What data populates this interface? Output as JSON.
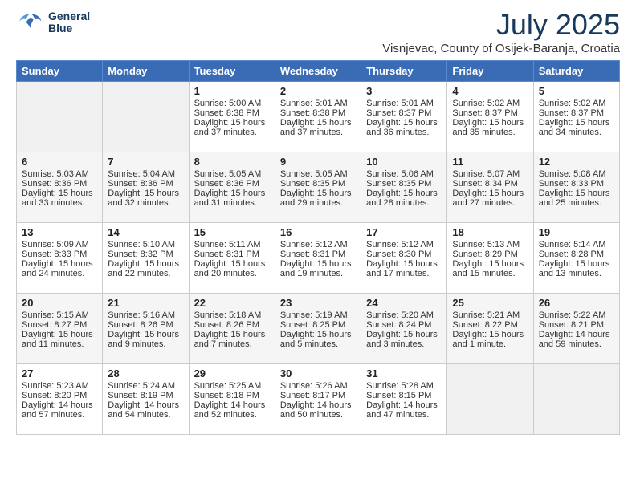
{
  "header": {
    "logo_line1": "General",
    "logo_line2": "Blue",
    "month_year": "July 2025",
    "location": "Visnjevac, County of Osijek-Baranja, Croatia"
  },
  "days_of_week": [
    "Sunday",
    "Monday",
    "Tuesday",
    "Wednesday",
    "Thursday",
    "Friday",
    "Saturday"
  ],
  "weeks": [
    [
      {
        "day": "",
        "content": ""
      },
      {
        "day": "",
        "content": ""
      },
      {
        "day": "1",
        "content": "Sunrise: 5:00 AM\nSunset: 8:38 PM\nDaylight: 15 hours and 37 minutes."
      },
      {
        "day": "2",
        "content": "Sunrise: 5:01 AM\nSunset: 8:38 PM\nDaylight: 15 hours and 37 minutes."
      },
      {
        "day": "3",
        "content": "Sunrise: 5:01 AM\nSunset: 8:37 PM\nDaylight: 15 hours and 36 minutes."
      },
      {
        "day": "4",
        "content": "Sunrise: 5:02 AM\nSunset: 8:37 PM\nDaylight: 15 hours and 35 minutes."
      },
      {
        "day": "5",
        "content": "Sunrise: 5:02 AM\nSunset: 8:37 PM\nDaylight: 15 hours and 34 minutes."
      }
    ],
    [
      {
        "day": "6",
        "content": "Sunrise: 5:03 AM\nSunset: 8:36 PM\nDaylight: 15 hours and 33 minutes."
      },
      {
        "day": "7",
        "content": "Sunrise: 5:04 AM\nSunset: 8:36 PM\nDaylight: 15 hours and 32 minutes."
      },
      {
        "day": "8",
        "content": "Sunrise: 5:05 AM\nSunset: 8:36 PM\nDaylight: 15 hours and 31 minutes."
      },
      {
        "day": "9",
        "content": "Sunrise: 5:05 AM\nSunset: 8:35 PM\nDaylight: 15 hours and 29 minutes."
      },
      {
        "day": "10",
        "content": "Sunrise: 5:06 AM\nSunset: 8:35 PM\nDaylight: 15 hours and 28 minutes."
      },
      {
        "day": "11",
        "content": "Sunrise: 5:07 AM\nSunset: 8:34 PM\nDaylight: 15 hours and 27 minutes."
      },
      {
        "day": "12",
        "content": "Sunrise: 5:08 AM\nSunset: 8:33 PM\nDaylight: 15 hours and 25 minutes."
      }
    ],
    [
      {
        "day": "13",
        "content": "Sunrise: 5:09 AM\nSunset: 8:33 PM\nDaylight: 15 hours and 24 minutes."
      },
      {
        "day": "14",
        "content": "Sunrise: 5:10 AM\nSunset: 8:32 PM\nDaylight: 15 hours and 22 minutes."
      },
      {
        "day": "15",
        "content": "Sunrise: 5:11 AM\nSunset: 8:31 PM\nDaylight: 15 hours and 20 minutes."
      },
      {
        "day": "16",
        "content": "Sunrise: 5:12 AM\nSunset: 8:31 PM\nDaylight: 15 hours and 19 minutes."
      },
      {
        "day": "17",
        "content": "Sunrise: 5:12 AM\nSunset: 8:30 PM\nDaylight: 15 hours and 17 minutes."
      },
      {
        "day": "18",
        "content": "Sunrise: 5:13 AM\nSunset: 8:29 PM\nDaylight: 15 hours and 15 minutes."
      },
      {
        "day": "19",
        "content": "Sunrise: 5:14 AM\nSunset: 8:28 PM\nDaylight: 15 hours and 13 minutes."
      }
    ],
    [
      {
        "day": "20",
        "content": "Sunrise: 5:15 AM\nSunset: 8:27 PM\nDaylight: 15 hours and 11 minutes."
      },
      {
        "day": "21",
        "content": "Sunrise: 5:16 AM\nSunset: 8:26 PM\nDaylight: 15 hours and 9 minutes."
      },
      {
        "day": "22",
        "content": "Sunrise: 5:18 AM\nSunset: 8:26 PM\nDaylight: 15 hours and 7 minutes."
      },
      {
        "day": "23",
        "content": "Sunrise: 5:19 AM\nSunset: 8:25 PM\nDaylight: 15 hours and 5 minutes."
      },
      {
        "day": "24",
        "content": "Sunrise: 5:20 AM\nSunset: 8:24 PM\nDaylight: 15 hours and 3 minutes."
      },
      {
        "day": "25",
        "content": "Sunrise: 5:21 AM\nSunset: 8:22 PM\nDaylight: 15 hours and 1 minute."
      },
      {
        "day": "26",
        "content": "Sunrise: 5:22 AM\nSunset: 8:21 PM\nDaylight: 14 hours and 59 minutes."
      }
    ],
    [
      {
        "day": "27",
        "content": "Sunrise: 5:23 AM\nSunset: 8:20 PM\nDaylight: 14 hours and 57 minutes."
      },
      {
        "day": "28",
        "content": "Sunrise: 5:24 AM\nSunset: 8:19 PM\nDaylight: 14 hours and 54 minutes."
      },
      {
        "day": "29",
        "content": "Sunrise: 5:25 AM\nSunset: 8:18 PM\nDaylight: 14 hours and 52 minutes."
      },
      {
        "day": "30",
        "content": "Sunrise: 5:26 AM\nSunset: 8:17 PM\nDaylight: 14 hours and 50 minutes."
      },
      {
        "day": "31",
        "content": "Sunrise: 5:28 AM\nSunset: 8:15 PM\nDaylight: 14 hours and 47 minutes."
      },
      {
        "day": "",
        "content": ""
      },
      {
        "day": "",
        "content": ""
      }
    ]
  ]
}
